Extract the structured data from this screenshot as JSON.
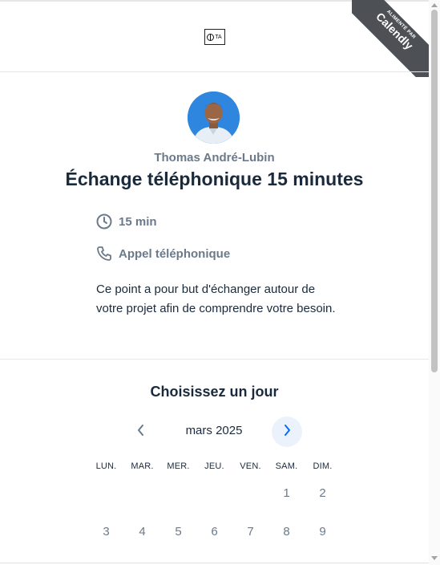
{
  "header": {
    "logo_text": "TA",
    "ribbon_small": "ALIMENTÉ PAR",
    "ribbon_brand": "Calendly"
  },
  "event": {
    "host": "Thomas André-Lubin",
    "title": "Échange téléphonique 15 minutes",
    "duration": "15 min",
    "location": "Appel téléphonique",
    "description": "Ce point a pour but d'échanger autour de votre projet afin de comprendre votre besoin."
  },
  "calendar": {
    "heading": "Choisissez un jour",
    "month": "mars 2025",
    "weekdays": [
      "LUN.",
      "MAR.",
      "MER.",
      "JEU.",
      "VEN.",
      "SAM.",
      "DIM."
    ],
    "week1": [
      "",
      "",
      "",
      "",
      "",
      "1",
      "2"
    ],
    "week2": [
      "3",
      "4",
      "5",
      "6",
      "7",
      "8",
      "9"
    ]
  },
  "colors": {
    "accent": "#006bff",
    "title": "#1a2a3d",
    "muted": "#6b7a8a",
    "ribbon": "#4d5055"
  },
  "icons": {
    "duration": "clock-icon",
    "location": "phone-icon",
    "prev": "chevron-left-icon",
    "next": "chevron-right-icon"
  }
}
